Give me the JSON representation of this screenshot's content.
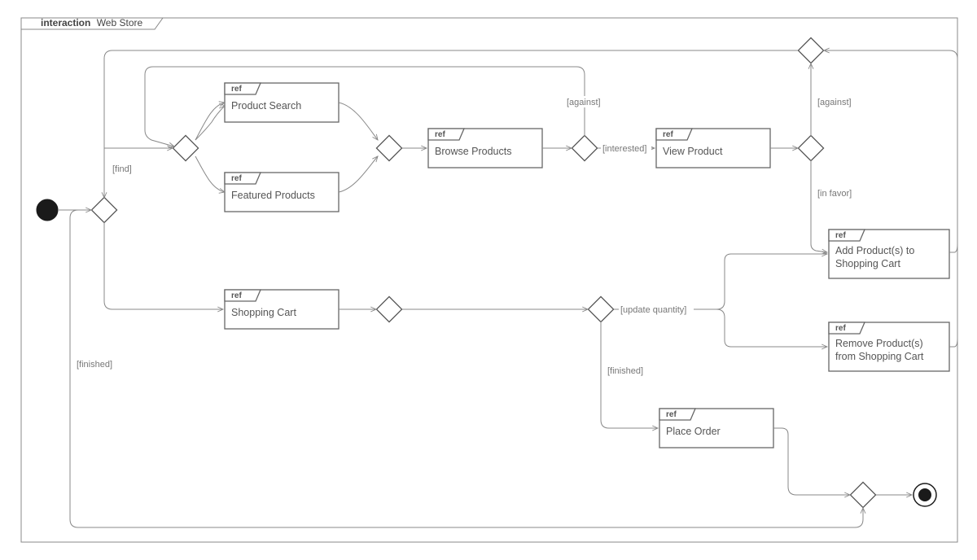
{
  "frame": {
    "keyword": "interaction",
    "name": "Web Store"
  },
  "refs": {
    "productSearch": "Product Search",
    "featuredProducts": "Featured Products",
    "browseProducts": "Browse Products",
    "viewProduct": "View Product",
    "shoppingCart": "Shopping Cart",
    "addToCart": "Add Product(s) to\nShopping Cart",
    "removeFromCart": "Remove Product(s)\nfrom Shopping Cart",
    "placeOrder": "Place Order",
    "refTag": "ref"
  },
  "guards": {
    "find": "[find]",
    "finishedLeft": "[finished]",
    "against1": "[against]",
    "interested": "[interested]",
    "against2": "[against]",
    "inFavor": "[in favor]",
    "updateQuantity": "[update quantity]",
    "finishedDown": "[finished]"
  }
}
